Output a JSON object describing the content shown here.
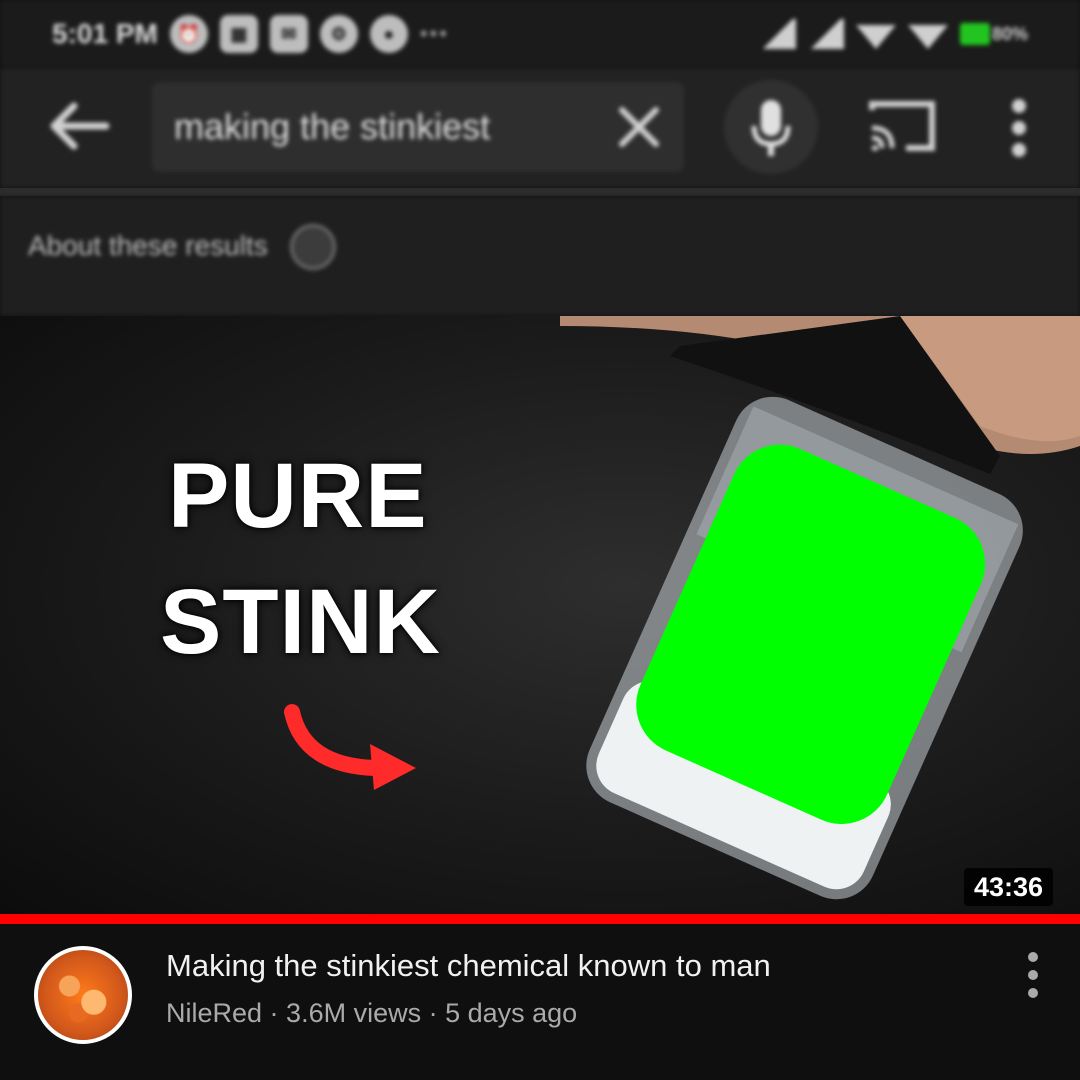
{
  "status_bar": {
    "time": "5:01 PM",
    "battery": "80%",
    "left_icons": [
      "alarm-icon",
      "calendar-icon",
      "message-icon",
      "settings-icon",
      "location-icon"
    ],
    "right_icons": [
      "signal-icon",
      "signal-icon",
      "wifi-icon",
      "wifi-icon",
      "battery-icon"
    ]
  },
  "search": {
    "query": "making the stinkiest"
  },
  "about_results": {
    "label": "About these results"
  },
  "thumbnail": {
    "overlay_line1": "PURE",
    "overlay_line2": "STINK",
    "duration": "43:36",
    "highlight_color": "#00ff00",
    "progress_fraction": 1.0,
    "progress_color": "#ff0000"
  },
  "video": {
    "title": "Making the stinkiest chemical known to man",
    "channel": "NileRed",
    "views": "3.6M views",
    "age": "5 days ago",
    "separator": " · "
  }
}
